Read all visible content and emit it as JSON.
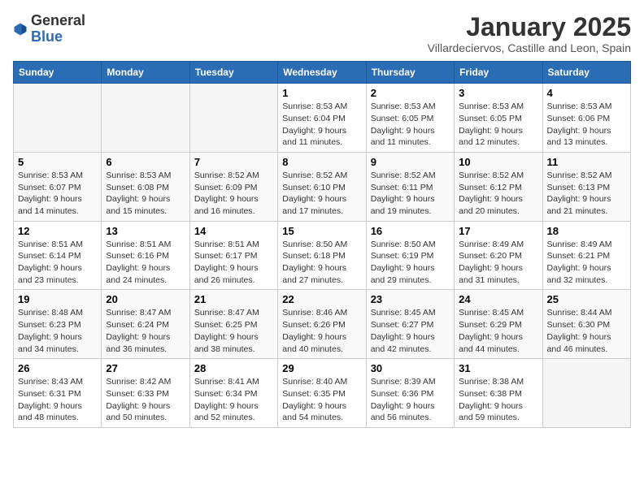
{
  "logo": {
    "general": "General",
    "blue": "Blue"
  },
  "header": {
    "title": "January 2025",
    "subtitle": "Villardeciervos, Castille and Leon, Spain"
  },
  "days": [
    "Sunday",
    "Monday",
    "Tuesday",
    "Wednesday",
    "Thursday",
    "Friday",
    "Saturday"
  ],
  "weeks": [
    [
      {
        "day": "",
        "text": ""
      },
      {
        "day": "",
        "text": ""
      },
      {
        "day": "",
        "text": ""
      },
      {
        "day": "1",
        "text": "Sunrise: 8:53 AM\nSunset: 6:04 PM\nDaylight: 9 hours and 11 minutes."
      },
      {
        "day": "2",
        "text": "Sunrise: 8:53 AM\nSunset: 6:05 PM\nDaylight: 9 hours and 11 minutes."
      },
      {
        "day": "3",
        "text": "Sunrise: 8:53 AM\nSunset: 6:05 PM\nDaylight: 9 hours and 12 minutes."
      },
      {
        "day": "4",
        "text": "Sunrise: 8:53 AM\nSunset: 6:06 PM\nDaylight: 9 hours and 13 minutes."
      }
    ],
    [
      {
        "day": "5",
        "text": "Sunrise: 8:53 AM\nSunset: 6:07 PM\nDaylight: 9 hours and 14 minutes."
      },
      {
        "day": "6",
        "text": "Sunrise: 8:53 AM\nSunset: 6:08 PM\nDaylight: 9 hours and 15 minutes."
      },
      {
        "day": "7",
        "text": "Sunrise: 8:52 AM\nSunset: 6:09 PM\nDaylight: 9 hours and 16 minutes."
      },
      {
        "day": "8",
        "text": "Sunrise: 8:52 AM\nSunset: 6:10 PM\nDaylight: 9 hours and 17 minutes."
      },
      {
        "day": "9",
        "text": "Sunrise: 8:52 AM\nSunset: 6:11 PM\nDaylight: 9 hours and 19 minutes."
      },
      {
        "day": "10",
        "text": "Sunrise: 8:52 AM\nSunset: 6:12 PM\nDaylight: 9 hours and 20 minutes."
      },
      {
        "day": "11",
        "text": "Sunrise: 8:52 AM\nSunset: 6:13 PM\nDaylight: 9 hours and 21 minutes."
      }
    ],
    [
      {
        "day": "12",
        "text": "Sunrise: 8:51 AM\nSunset: 6:14 PM\nDaylight: 9 hours and 23 minutes."
      },
      {
        "day": "13",
        "text": "Sunrise: 8:51 AM\nSunset: 6:16 PM\nDaylight: 9 hours and 24 minutes."
      },
      {
        "day": "14",
        "text": "Sunrise: 8:51 AM\nSunset: 6:17 PM\nDaylight: 9 hours and 26 minutes."
      },
      {
        "day": "15",
        "text": "Sunrise: 8:50 AM\nSunset: 6:18 PM\nDaylight: 9 hours and 27 minutes."
      },
      {
        "day": "16",
        "text": "Sunrise: 8:50 AM\nSunset: 6:19 PM\nDaylight: 9 hours and 29 minutes."
      },
      {
        "day": "17",
        "text": "Sunrise: 8:49 AM\nSunset: 6:20 PM\nDaylight: 9 hours and 31 minutes."
      },
      {
        "day": "18",
        "text": "Sunrise: 8:49 AM\nSunset: 6:21 PM\nDaylight: 9 hours and 32 minutes."
      }
    ],
    [
      {
        "day": "19",
        "text": "Sunrise: 8:48 AM\nSunset: 6:23 PM\nDaylight: 9 hours and 34 minutes."
      },
      {
        "day": "20",
        "text": "Sunrise: 8:47 AM\nSunset: 6:24 PM\nDaylight: 9 hours and 36 minutes."
      },
      {
        "day": "21",
        "text": "Sunrise: 8:47 AM\nSunset: 6:25 PM\nDaylight: 9 hours and 38 minutes."
      },
      {
        "day": "22",
        "text": "Sunrise: 8:46 AM\nSunset: 6:26 PM\nDaylight: 9 hours and 40 minutes."
      },
      {
        "day": "23",
        "text": "Sunrise: 8:45 AM\nSunset: 6:27 PM\nDaylight: 9 hours and 42 minutes."
      },
      {
        "day": "24",
        "text": "Sunrise: 8:45 AM\nSunset: 6:29 PM\nDaylight: 9 hours and 44 minutes."
      },
      {
        "day": "25",
        "text": "Sunrise: 8:44 AM\nSunset: 6:30 PM\nDaylight: 9 hours and 46 minutes."
      }
    ],
    [
      {
        "day": "26",
        "text": "Sunrise: 8:43 AM\nSunset: 6:31 PM\nDaylight: 9 hours and 48 minutes."
      },
      {
        "day": "27",
        "text": "Sunrise: 8:42 AM\nSunset: 6:33 PM\nDaylight: 9 hours and 50 minutes."
      },
      {
        "day": "28",
        "text": "Sunrise: 8:41 AM\nSunset: 6:34 PM\nDaylight: 9 hours and 52 minutes."
      },
      {
        "day": "29",
        "text": "Sunrise: 8:40 AM\nSunset: 6:35 PM\nDaylight: 9 hours and 54 minutes."
      },
      {
        "day": "30",
        "text": "Sunrise: 8:39 AM\nSunset: 6:36 PM\nDaylight: 9 hours and 56 minutes."
      },
      {
        "day": "31",
        "text": "Sunrise: 8:38 AM\nSunset: 6:38 PM\nDaylight: 9 hours and 59 minutes."
      },
      {
        "day": "",
        "text": ""
      }
    ]
  ]
}
